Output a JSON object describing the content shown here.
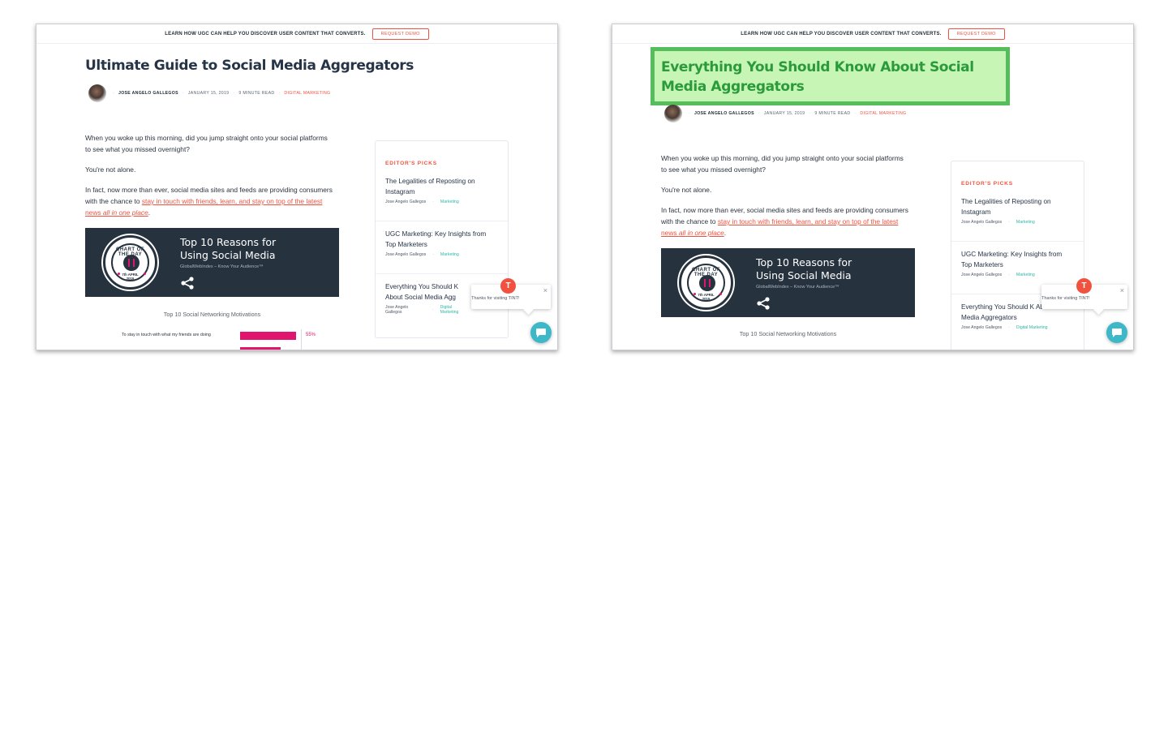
{
  "screens": [
    {
      "promo": {
        "text": "LEARN HOW UGC CAN HELP YOU DISCOVER USER CONTENT THAT CONVERTS.",
        "button": "REQUEST DEMO"
      },
      "title": "Ultimate Guide to Social Media Aggregators",
      "meta": {
        "author": "JOSE ANGELO GALLEGOS",
        "date": "JANUARY 15, 2019",
        "read_time": "9 MINUTE READ",
        "category": "DIGITAL MARKETING"
      },
      "article": {
        "p1": "When you woke up this morning, did you jump straight onto your social platforms to see what you missed overnight?",
        "p2": "You're not alone.",
        "p3_prefix": "In fact, now more than ever, social media sites and feeds are providing consumers with the chance to ",
        "p3_link": "stay in touch with friends, learn, and stay on top of the latest news ",
        "p3_link_em": "all in one place",
        "p3_suffix": "."
      },
      "banner": {
        "badge_top": "CHART OF THE DAY",
        "badge_date": "7th APRIL",
        "badge_year": "2015",
        "title": "Top 10 Reasons for Using Social Media",
        "subtitle": "GlobalWebIndex – Know Your Audience™"
      },
      "chart_caption": "Top 10 Social Networking Motivations",
      "chart_data": {
        "type": "bar",
        "categories": [
          "To stay in touch with what my friends are doing"
        ],
        "values": [
          55
        ],
        "value_labels": [
          "55%"
        ]
      },
      "sidebar": {
        "heading": "EDITOR'S PICKS",
        "picks": [
          {
            "title": "The Legalities of Reposting on Instagram",
            "author": "Jose Angelo Gallegos",
            "tag": "Marketing"
          },
          {
            "title": "UGC Marketing: Key Insights from Top Marketers",
            "author": "Jose Angelo Gallegos",
            "tag": "Marketing"
          },
          {
            "title": "Everything You Should K About Social Media Agg",
            "author": "Jose Angelo Gallegos",
            "tag": "Digital Marketing"
          }
        ]
      },
      "popup": {
        "text": "Thanks for visiting TINT!",
        "close": "×",
        "logo": "T"
      }
    },
    {
      "promo": {
        "text": "LEARN HOW UGC CAN HELP YOU DISCOVER USER CONTENT THAT CONVERTS.",
        "button": "REQUEST DEMO"
      },
      "title": "Everything You Should Know About Social Media Aggregators",
      "meta": {
        "author": "JOSE ANGELO GALLEGOS",
        "date": "JANUARY 15, 2019",
        "read_time": "9 MINUTE READ",
        "category": "DIGITAL MARKETING"
      },
      "article": {
        "p1": "When you woke up this morning, did you jump straight onto your social platforms to see what you missed overnight?",
        "p2": "You're not alone.",
        "p3_prefix": "In fact, now more than ever, social media sites and feeds are providing consumers with the chance to ",
        "p3_link": "stay in touch with friends, learn, and stay on top of the latest news ",
        "p3_link_em": "all in one place",
        "p3_suffix": "."
      },
      "banner": {
        "badge_top": "CHART OF THE DAY",
        "badge_date": "7th APRIL",
        "badge_year": "2015",
        "title": "Top 10 Reasons for Using Social Media",
        "subtitle": "GlobalWebIndex – Know Your Audience™"
      },
      "chart_caption": "Top 10 Social Networking Motivations",
      "sidebar": {
        "heading": "EDITOR'S PICKS",
        "picks": [
          {
            "title": "The Legalities of Reposting on Instagram",
            "author": "Jose Angelo Gallegos",
            "tag": "Marketing"
          },
          {
            "title": "UGC Marketing: Key Insights from Top Marketers",
            "author": "Jose Angelo Gallegos",
            "tag": "Marketing"
          },
          {
            "title": "Everything You Should K About Social Media Aggregators",
            "author": "Jose Angelo Gallegos",
            "tag": "Digital Marketing"
          }
        ]
      },
      "popup": {
        "text": "Thanks for visiting TINT!",
        "close": "×",
        "logo": "T"
      }
    }
  ],
  "colors": {
    "accent": "#f0523f",
    "navy": "#27323f",
    "teal": "#2bb7a5",
    "highlight_fill": "#c6f5b6",
    "highlight_border": "#55bd5b",
    "chart_bar": "#e0166e"
  }
}
